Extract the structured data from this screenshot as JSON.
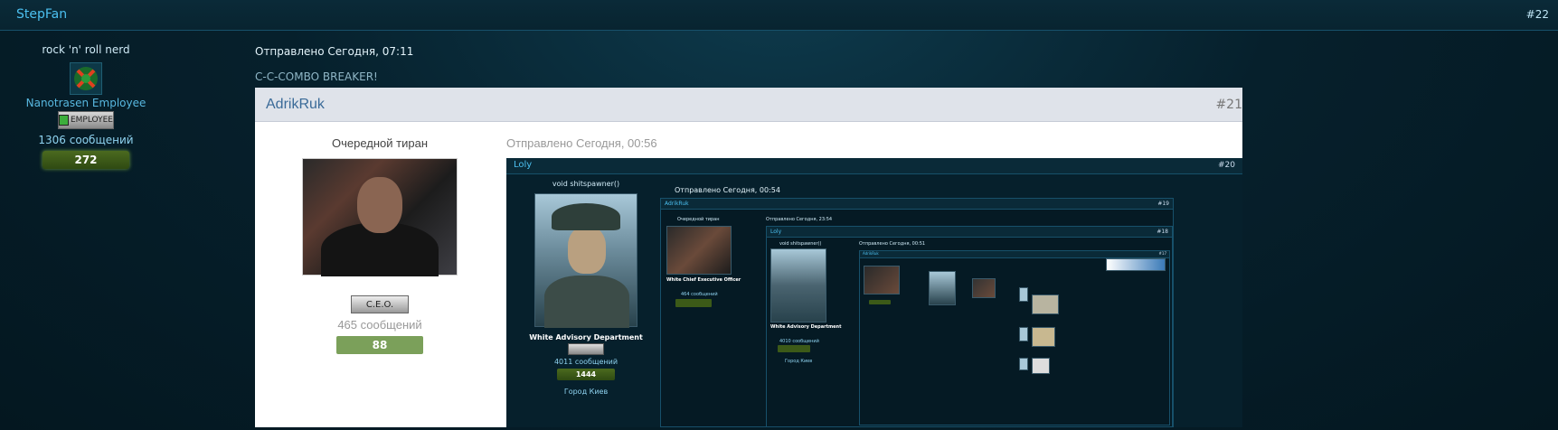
{
  "post": {
    "author": "StepFan",
    "number": "#22",
    "user_title": "rock 'n' roll nerd",
    "group": "Nanotrasen Employee",
    "rank_text": "EMPLOYEE",
    "post_count": "1306 сообщений",
    "reputation": "272",
    "date": "Отправлено Сегодня, 07:11",
    "text": "C-C-COMBO BREAKER!"
  },
  "quote": {
    "author": "AdrikRuk",
    "number": "#21",
    "user_title": "Очередной тиран",
    "rank_text": "C.E.O.",
    "post_count": "465 сообщений",
    "reputation": "88",
    "date": "Отправлено Сегодня, 00:56"
  },
  "nested": {
    "author": "Loly",
    "number": "#20",
    "user_title": "void shitspawner()",
    "group": "White Advisory Department",
    "post_count": "4011 сообщений",
    "reputation": "1444",
    "city": "Город Киев",
    "date": "Отправлено Сегодня, 00:54",
    "deep1": {
      "author": "AdrikRuk",
      "number": "#19",
      "user_title": "Очередной тиран",
      "group": "White Chief Executive Officer",
      "post_count": "464 сообщений",
      "reputation": "88",
      "date": "Отправлено Сегодня, 23:54"
    },
    "deep2": {
      "author": "Loly",
      "number": "#18",
      "user_title": "void shitspawner()",
      "group": "White Advisory Department",
      "post_count": "4010 сообщений",
      "reputation": "1444",
      "city": "Город Киев",
      "date": "Отправлено Сегодня, 00:51"
    },
    "deep3": {
      "author": "AdrikRuk",
      "number": "#17"
    }
  },
  "colors": {
    "accent": "#4cc0f0",
    "reputation_green": "#4b6a1f",
    "quote_reputation": "#7ba05a"
  }
}
